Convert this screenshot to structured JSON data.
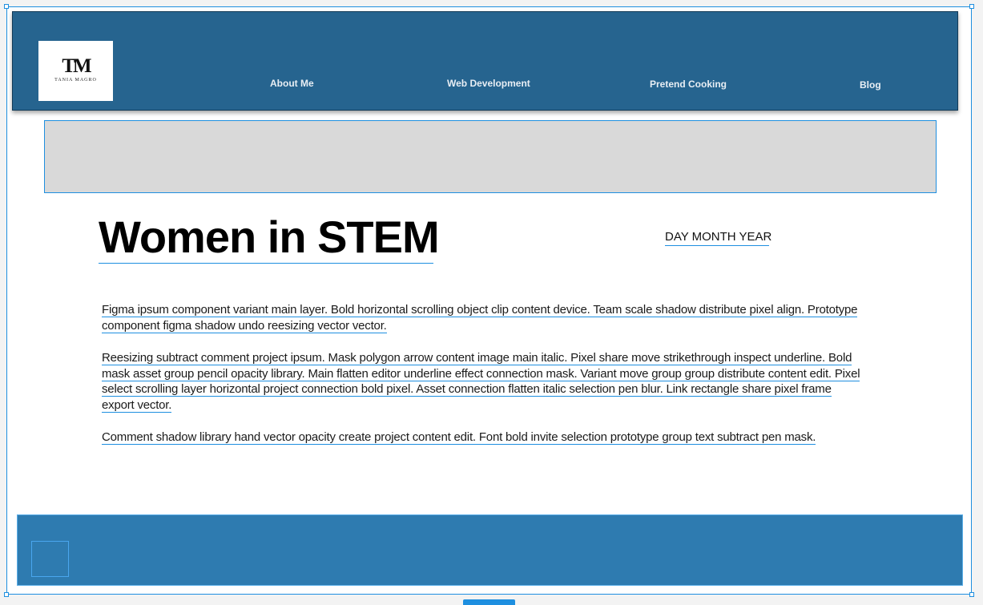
{
  "header": {
    "logo": {
      "mark": "TM",
      "name": "TANIA MAGRO"
    },
    "nav": [
      {
        "label": "About Me"
      },
      {
        "label": "Web Development"
      },
      {
        "label": "Pretend Cooking"
      },
      {
        "label": "Blog"
      }
    ]
  },
  "article": {
    "title": "Women in STEM",
    "date": "DAY MONTH YEAR",
    "paragraphs": [
      "Figma ipsum component variant main layer. Bold horizontal scrolling object clip content device. Team scale shadow distribute pixel align. Prototype component figma shadow undo reesizing vector vector.",
      "Reesizing subtract comment project ipsum. Mask polygon arrow content image main italic. Pixel share move strikethrough inspect underline. Bold mask asset group pencil opacity library. Main flatten editor underline effect connection mask. Variant move group group distribute content edit. Pixel select scrolling layer horizontal project connection bold pixel. Asset connection flatten italic selection pen blur. Link rectangle share pixel frame export vector.",
      "Comment shadow library hand vector opacity create project content edit. Font bold invite selection prototype group text subtract pen mask."
    ]
  },
  "colors": {
    "header": "#26648f",
    "footer": "#2e7bb0",
    "banner": "#d9d9d9",
    "selection": "#1e8fe0"
  }
}
